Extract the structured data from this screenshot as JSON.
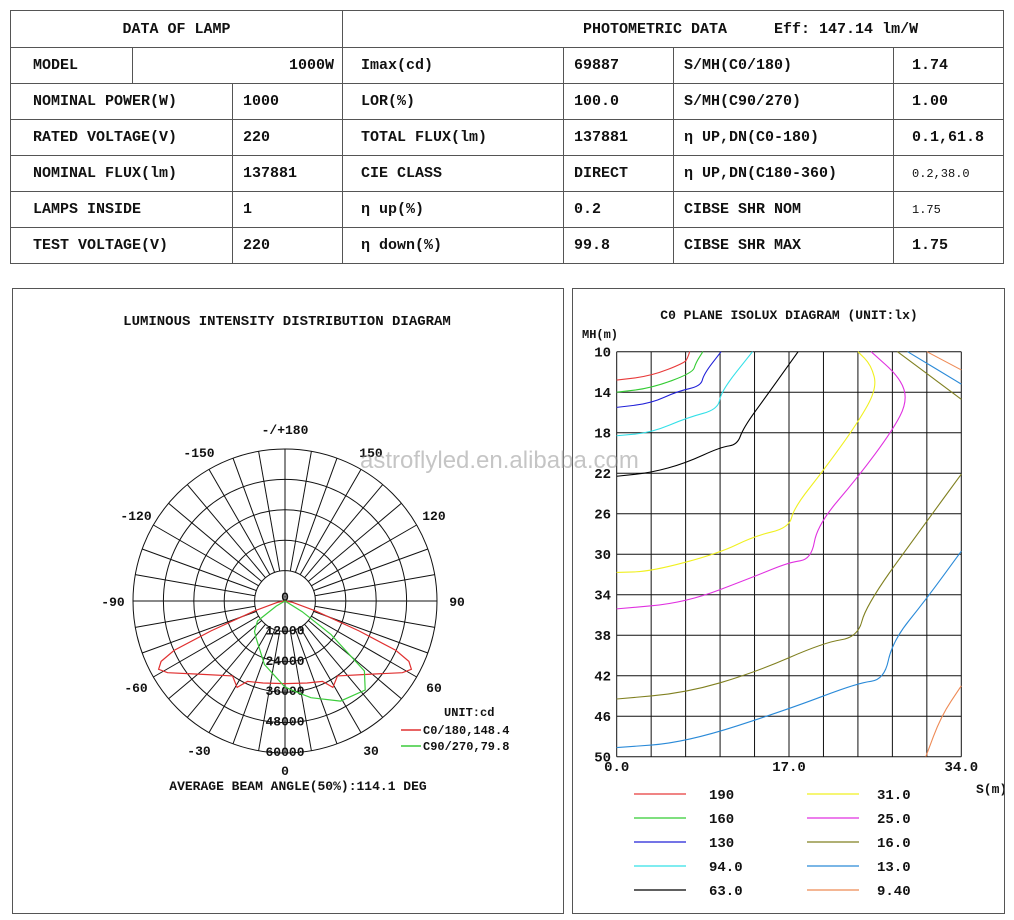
{
  "lamp_header": "DATA OF LAMP",
  "photometric_header": "PHOTOMETRIC DATA",
  "efficiency": "Eff: 147.14 lm/W",
  "lamp_rows": [
    {
      "label": "MODEL",
      "value": "1000W"
    },
    {
      "label": "NOMINAL POWER(W)",
      "value": "1000"
    },
    {
      "label": "RATED VOLTAGE(V)",
      "value": "220"
    },
    {
      "label": "NOMINAL FLUX(lm)",
      "value": "137881"
    },
    {
      "label": "LAMPS INSIDE",
      "value": "1"
    },
    {
      "label": "TEST VOLTAGE(V)",
      "value": "220"
    }
  ],
  "photo_rows": [
    {
      "label": "Imax(cd)",
      "value": "69887",
      "label2": "S/MH(C0/180)",
      "value2": "1.74"
    },
    {
      "label": "LOR(%)",
      "value": "100.0",
      "label2": "S/MH(C90/270)",
      "value2": "1.00"
    },
    {
      "label": "TOTAL FLUX(lm)",
      "value": "137881",
      "label2": "η UP,DN(C0-180)",
      "value2": "0.1,61.8"
    },
    {
      "label": "CIE CLASS",
      "value": "DIRECT",
      "label2": "η UP,DN(C180-360)",
      "value2": "0.2,38.0"
    },
    {
      "label": "η up(%)",
      "value": "0.2",
      "label2": "CIBSE SHR NOM",
      "value2": "1.75"
    },
    {
      "label": "η down(%)",
      "value": "99.8",
      "label2": "CIBSE SHR MAX",
      "value2": "1.75"
    }
  ],
  "watermark": "astroflyled.en.alibaba.com",
  "chart_data": [
    {
      "type": "polar",
      "title": "LUMINOUS INTENSITY DISTRIBUTION DIAGRAM",
      "unit_label": "UNIT:cd",
      "footer": "AVERAGE BEAM ANGLE(50%):114.1 DEG",
      "angle_labels": [
        {
          "angle": 180,
          "text": "-/+180"
        },
        {
          "angle": -150,
          "text": "-150"
        },
        {
          "angle": 150,
          "text": "150"
        },
        {
          "angle": -120,
          "text": "-120"
        },
        {
          "angle": 120,
          "text": "120"
        },
        {
          "angle": -90,
          "text": "-90"
        },
        {
          "angle": 90,
          "text": "90"
        },
        {
          "angle": -60,
          "text": "-60"
        },
        {
          "angle": 60,
          "text": "60"
        },
        {
          "angle": -30,
          "text": "-30"
        },
        {
          "angle": 30,
          "text": "30"
        },
        {
          "angle": 0,
          "text": "0"
        }
      ],
      "radial_ticks": [
        "0",
        "12000",
        "24000",
        "36000",
        "48000",
        "60000"
      ],
      "rmax": 60000,
      "series": [
        {
          "name": "C0/180,148.4",
          "color": "#e03030",
          "points": [
            [
              -90,
              0
            ],
            [
              -80,
              3000
            ],
            [
              -72,
              12700
            ],
            [
              -68,
              31600
            ],
            [
              -66,
              47900
            ],
            [
              -64,
              54400
            ],
            [
              -61.6,
              56700
            ],
            [
              -58.6,
              54300
            ],
            [
              -50,
              44900
            ],
            [
              -35,
              36100
            ],
            [
              -29,
              39000
            ],
            [
              -25,
              35000
            ],
            [
              -15,
              33500
            ],
            [
              0,
              32600
            ],
            [
              15,
              33500
            ],
            [
              25,
              35000
            ],
            [
              29,
              39000
            ],
            [
              35,
              36100
            ],
            [
              50,
              44900
            ],
            [
              58.6,
              54300
            ],
            [
              61.6,
              56700
            ],
            [
              64,
              54400
            ],
            [
              66,
              47900
            ],
            [
              68,
              31600
            ],
            [
              72,
              12700
            ],
            [
              80,
              3000
            ],
            [
              90,
              0
            ]
          ]
        },
        {
          "name": "C90/270,79.8",
          "color": "#3ccc3c",
          "points": [
            [
              -70,
              0
            ],
            [
              -60,
              4000
            ],
            [
              -54,
              13400
            ],
            [
              -45,
              17000
            ],
            [
              -38,
              18500
            ],
            [
              -18,
              26300
            ],
            [
              0,
              34000
            ],
            [
              8,
              36500
            ],
            [
              15,
              39500
            ],
            [
              29,
              45200
            ],
            [
              42,
              47300
            ],
            [
              48.6,
              41800
            ],
            [
              54,
              22400
            ],
            [
              58,
              8000
            ],
            [
              62,
              0
            ]
          ]
        }
      ]
    },
    {
      "type": "line",
      "title": "C0 PLANE ISOLUX DIAGRAM (UNIT:lx)",
      "ylabel": "MH(m)",
      "xlabel": "S(m)",
      "xlim": [
        0,
        34
      ],
      "ylim": [
        10,
        50
      ],
      "xticks": [
        "0.0",
        "17.0",
        "34.0"
      ],
      "yticks": [
        "10",
        "14",
        "18",
        "22",
        "26",
        "30",
        "34",
        "38",
        "42",
        "46",
        "50"
      ],
      "series": [
        {
          "name": "190",
          "color": "#e83a3a",
          "segments": [
            [
              [
                0,
                12.8
              ],
              [
                3.4,
                12.4
              ],
              [
                6.7,
                11.1
              ],
              [
                7.0,
                10.6
              ],
              [
                7.2,
                10
              ]
            ]
          ]
        },
        {
          "name": "160",
          "color": "#33cc33",
          "segments": [
            [
              [
                0,
                14
              ],
              [
                3.4,
                13.6
              ],
              [
                7.5,
                12.1
              ],
              [
                7.8,
                11.1
              ],
              [
                8.5,
                10
              ]
            ]
          ]
        },
        {
          "name": "130",
          "color": "#2020d8",
          "segments": [
            [
              [
                0,
                15.5
              ],
              [
                3.4,
                15.1
              ],
              [
                6.0,
                13.9
              ],
              [
                8.3,
                13.4
              ],
              [
                8.6,
                12.2
              ],
              [
                10.3,
                10
              ]
            ]
          ]
        },
        {
          "name": "94.0",
          "color": "#33e0e8",
          "segments": [
            [
              [
                0,
                18.3
              ],
              [
                3.4,
                18
              ],
              [
                7,
                16.5
              ],
              [
                10,
                15.7
              ],
              [
                10.3,
                13.9
              ],
              [
                13.4,
                10
              ]
            ]
          ]
        },
        {
          "name": "63.0",
          "color": "#000000",
          "segments": [
            [
              [
                0,
                22.3
              ],
              [
                3.4,
                21.95
              ],
              [
                6.8,
                21
              ],
              [
                10.3,
                19.4
              ],
              [
                11.9,
                19.2
              ],
              [
                12.5,
                17.5
              ],
              [
                14.9,
                14.2
              ],
              [
                17.9,
                10
              ]
            ]
          ]
        },
        {
          "name": "31.0",
          "color": "#f0f020",
          "segments": [
            [
              [
                0,
                31.8
              ],
              [
                3.4,
                31.7
              ],
              [
                10.1,
                29.9
              ],
              [
                13.6,
                28.2
              ],
              [
                17,
                27.4
              ],
              [
                17.5,
                25.4
              ],
              [
                20.5,
                21.6
              ],
              [
                23.8,
                17
              ],
              [
                25.7,
                13.6
              ],
              [
                25.1,
                11.3
              ],
              [
                23.8,
                10
              ]
            ]
          ]
        },
        {
          "name": "25.0",
          "color": "#e030e0",
          "segments": [
            [
              [
                0,
                35.4
              ],
              [
                6.8,
                34.8
              ],
              [
                13.6,
                32.2
              ],
              [
                17,
                30.8
              ],
              [
                19.2,
                30.5
              ],
              [
                19.8,
                27.1
              ],
              [
                23.8,
                22.4
              ],
              [
                27.2,
                17.8
              ],
              [
                28.7,
                14.9
              ],
              [
                28,
                12.6
              ],
              [
                25.1,
                10
              ]
            ]
          ]
        },
        {
          "name": "16.0",
          "color": "#808020",
          "segments": [
            [
              [
                0,
                44.3
              ],
              [
                6.8,
                43.7
              ],
              [
                13.6,
                41.7
              ],
              [
                20.5,
                38.7
              ],
              [
                23.8,
                38.2
              ],
              [
                24.6,
                35
              ],
              [
                30.7,
                26.6
              ],
              [
                34,
                22.1
              ]
            ],
            [
              [
                27.7,
                10
              ],
              [
                34,
                14.7
              ]
            ]
          ]
        },
        {
          "name": "13.0",
          "color": "#2a8ad8",
          "segments": [
            [
              [
                0,
                49.1
              ],
              [
                6.8,
                48.6
              ],
              [
                17,
                45.3
              ],
              [
                23.8,
                42.7
              ],
              [
                26.4,
                42.4
              ],
              [
                27.2,
                38.6
              ],
              [
                30.5,
                34.5
              ],
              [
                34,
                29.7
              ]
            ],
            [
              [
                28.7,
                10
              ],
              [
                34,
                13.2
              ]
            ]
          ]
        },
        {
          "name": "9.40",
          "color": "#ee8a55",
          "segments": [
            [
              [
                30.5,
                50
              ],
              [
                32,
                46
              ],
              [
                34,
                43
              ]
            ],
            [
              [
                30.6,
                10
              ],
              [
                34,
                11.8
              ]
            ]
          ]
        }
      ]
    }
  ]
}
